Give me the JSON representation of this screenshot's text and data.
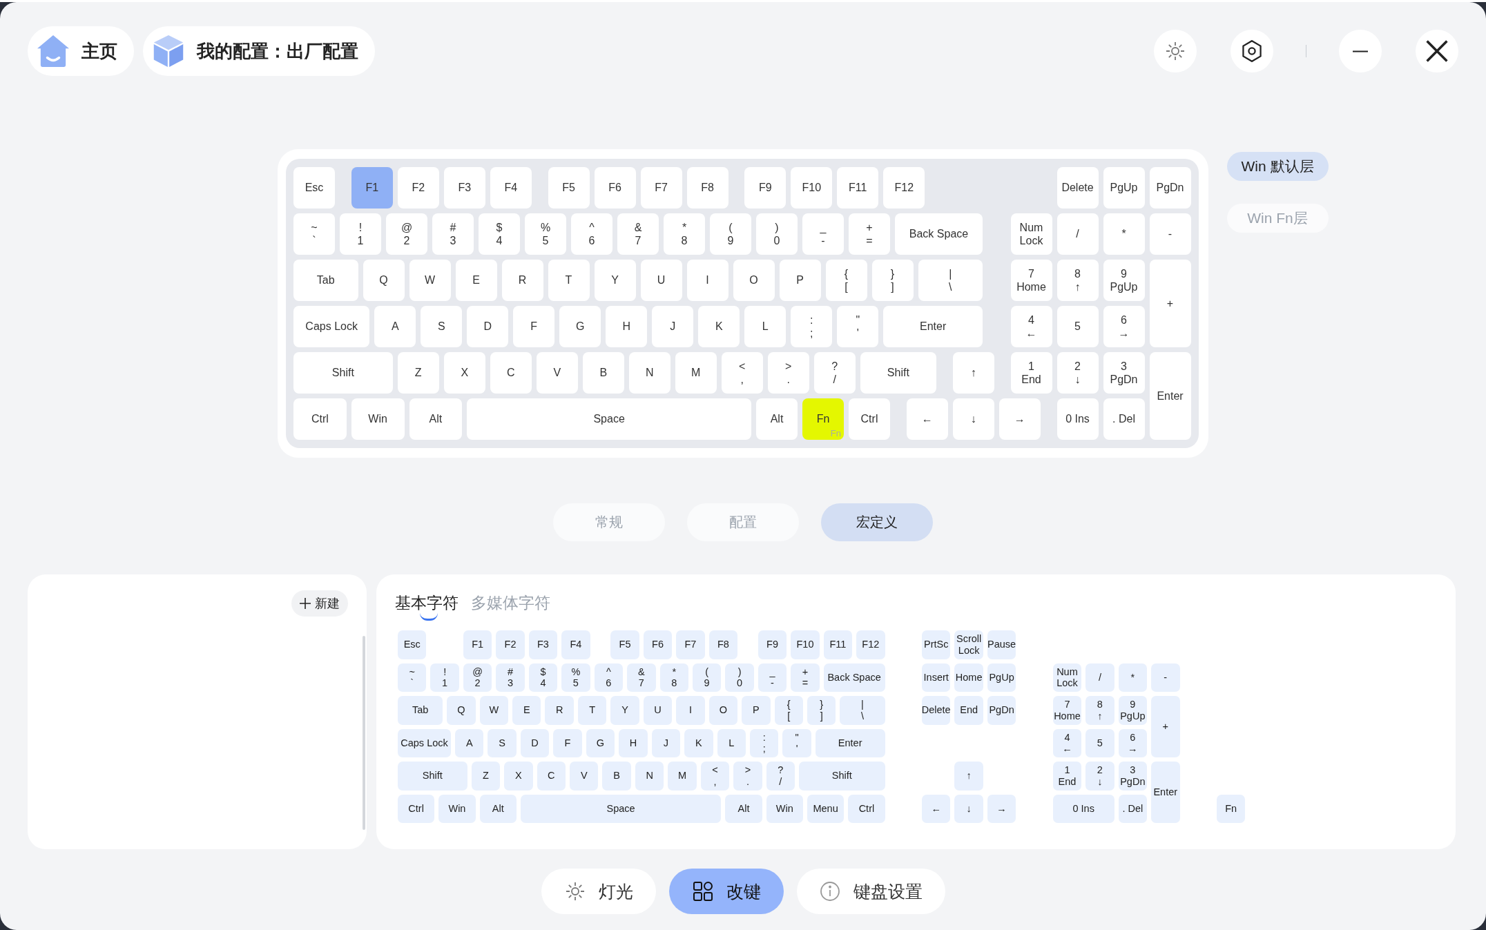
{
  "header": {
    "home": "主页",
    "profile": "我的配置：出厂配置"
  },
  "keyboard": {
    "main_rows": [
      [
        {
          "label": "Esc",
          "selected": false
        },
        {
          "label": "F1",
          "selected": true
        },
        {
          "label": "F2",
          "selected": false
        },
        {
          "label": "F3",
          "selected": false
        },
        {
          "label": "F4",
          "selected": false
        },
        {
          "label": "F5",
          "selected": false
        },
        {
          "label": "F6",
          "selected": false
        },
        {
          "label": "F7",
          "selected": false
        },
        {
          "label": "F8",
          "selected": false
        },
        {
          "label": "F9",
          "selected": false
        },
        {
          "label": "F10",
          "selected": false
        },
        {
          "label": "F11",
          "selected": false
        },
        {
          "label": "F12",
          "selected": false
        }
      ],
      [
        {
          "label": "~\n`",
          "selected": false
        },
        {
          "label": "!\n1",
          "selected": false
        },
        {
          "label": "@\n2",
          "selected": false
        },
        {
          "label": "#\n3",
          "selected": false
        },
        {
          "label": "$\n4",
          "selected": false
        },
        {
          "label": "%\n5",
          "selected": false
        },
        {
          "label": "^\n6",
          "selected": false
        },
        {
          "label": "&\n7",
          "selected": false
        },
        {
          "label": "*\n8",
          "selected": false
        },
        {
          "label": "(\n9",
          "selected": false
        },
        {
          "label": ")\n0",
          "selected": false
        },
        {
          "label": "_\n-",
          "selected": false
        },
        {
          "label": "+\n=",
          "selected": false
        },
        {
          "label": "Back Space",
          "selected": false
        }
      ],
      [
        {
          "label": "Tab",
          "selected": false
        },
        {
          "label": "Q",
          "selected": false
        },
        {
          "label": "W",
          "selected": false
        },
        {
          "label": "E",
          "selected": false
        },
        {
          "label": "R",
          "selected": false
        },
        {
          "label": "T",
          "selected": false
        },
        {
          "label": "Y",
          "selected": false
        },
        {
          "label": "U",
          "selected": false
        },
        {
          "label": "I",
          "selected": false
        },
        {
          "label": "O",
          "selected": false
        },
        {
          "label": "P",
          "selected": false
        },
        {
          "label": "{\n[",
          "selected": false
        },
        {
          "label": "}\n]",
          "selected": false
        },
        {
          "label": "|\n\\",
          "selected": false
        }
      ],
      [
        {
          "label": "Caps Lock",
          "selected": false
        },
        {
          "label": "A",
          "selected": false
        },
        {
          "label": "S",
          "selected": false
        },
        {
          "label": "D",
          "selected": false
        },
        {
          "label": "F",
          "selected": false
        },
        {
          "label": "G",
          "selected": false
        },
        {
          "label": "H",
          "selected": false
        },
        {
          "label": "J",
          "selected": false
        },
        {
          "label": "K",
          "selected": false
        },
        {
          "label": "L",
          "selected": false
        },
        {
          "label": ":\n;",
          "selected": false
        },
        {
          "label": "\"\n'",
          "selected": false
        },
        {
          "label": "Enter",
          "selected": false
        }
      ],
      [
        {
          "label": "Shift",
          "selected": false
        },
        {
          "label": "Z",
          "selected": false
        },
        {
          "label": "X",
          "selected": false
        },
        {
          "label": "C",
          "selected": false
        },
        {
          "label": "V",
          "selected": false
        },
        {
          "label": "B",
          "selected": false
        },
        {
          "label": "N",
          "selected": false
        },
        {
          "label": "M",
          "selected": false
        },
        {
          "label": "<\n,",
          "selected": false
        },
        {
          "label": ">\n.",
          "selected": false
        },
        {
          "label": "?\n/",
          "selected": false
        },
        {
          "label": "Shift",
          "selected": false
        },
        {
          "label": "↑",
          "selected": false
        }
      ],
      [
        {
          "label": "Ctrl",
          "selected": false
        },
        {
          "label": "Win",
          "selected": false
        },
        {
          "label": "Alt",
          "selected": false
        },
        {
          "label": "Space",
          "selected": false
        },
        {
          "label": "Alt",
          "selected": false
        },
        {
          "label": "Fn",
          "sublabel": "Fn",
          "color": "#e4f700",
          "selected": false
        },
        {
          "label": "Ctrl",
          "selected": false
        },
        {
          "label": "←",
          "selected": false
        },
        {
          "label": "↓",
          "selected": false
        },
        {
          "label": "→",
          "selected": false
        }
      ]
    ],
    "numpad_rows": [
      [
        "",
        {
          "label": "Delete",
          "selected": false
        },
        {
          "label": "PgUp",
          "selected": false
        },
        {
          "label": "PgDn",
          "selected": false
        }
      ],
      [
        {
          "label": "Num\nLock",
          "selected": false
        },
        {
          "label": "/",
          "selected": false
        },
        {
          "label": "*",
          "selected": false
        },
        {
          "label": "-",
          "selected": false
        }
      ],
      [
        {
          "label": "7\nHome",
          "selected": false
        },
        {
          "label": "8\n↑",
          "selected": false
        },
        {
          "label": "9\nPgUp",
          "selected": false
        },
        {
          "label": "+",
          "selected": false
        }
      ],
      [
        {
          "label": "4\n←",
          "selected": false
        },
        {
          "label": "5",
          "selected": false
        },
        {
          "label": "6\n→",
          "selected": false
        }
      ],
      [
        {
          "label": "1\nEnd",
          "selected": false
        },
        {
          "label": "2\n↓",
          "selected": false
        },
        {
          "label": "3\nPgDn",
          "selected": false
        },
        {
          "label": "Enter",
          "selected": false
        }
      ],
      [
        "",
        {
          "label": "0 Ins",
          "selected": false
        },
        {
          "label": ". Del",
          "selected": false
        }
      ]
    ]
  },
  "layers": [
    {
      "label": "Win 默认层",
      "selected": true
    },
    {
      "label": "Win Fn层",
      "selected": false
    }
  ],
  "modes": [
    {
      "label": "常规",
      "selected": false
    },
    {
      "label": "配置",
      "selected": false
    },
    {
      "label": "宏定义",
      "selected": true
    }
  ],
  "macro_list": {
    "new_button": "新建"
  },
  "key_picker": {
    "tabs": [
      {
        "label": "基本字符",
        "selected": true
      },
      {
        "label": "多媒体字符",
        "selected": false
      }
    ],
    "main_rows": [
      [
        "Esc",
        "F1",
        "F2",
        "F3",
        "F4",
        "F5",
        "F6",
        "F7",
        "F8",
        "F9",
        "F10",
        "F11",
        "F12"
      ],
      [
        "~\n`",
        "!\n1",
        "@\n2",
        "#\n3",
        "$\n4",
        "%\n5",
        "^\n6",
        "&\n7",
        "*\n8",
        "(\n9",
        ")\n0",
        "_\n-",
        "+\n=",
        "Back Space"
      ],
      [
        "Tab",
        "Q",
        "W",
        "E",
        "R",
        "T",
        "Y",
        "U",
        "I",
        "O",
        "P",
        "{\n[",
        "}\n]",
        "|\n\\"
      ],
      [
        "Caps Lock",
        "A",
        "S",
        "D",
        "F",
        "G",
        "H",
        "J",
        "K",
        "L",
        ":\n;",
        "\"\n'",
        "Enter"
      ],
      [
        "Shift",
        "Z",
        "X",
        "C",
        "V",
        "B",
        "N",
        "M",
        "<\n,",
        ">\n.",
        "?\n/",
        "Shift"
      ],
      [
        "Ctrl",
        "Win",
        "Alt",
        "Space",
        "Alt",
        "Win",
        "Menu",
        "Ctrl"
      ]
    ],
    "nav_rows": [
      [
        "PrtSc",
        "Scroll\nLock",
        "Pause"
      ],
      [
        "Insert",
        "Home",
        "PgUp"
      ],
      [
        "Delete",
        "End",
        "PgDn"
      ],
      [
        "",
        "↑"
      ],
      [
        "←",
        "↓",
        "→"
      ]
    ],
    "numpad_rows": [
      [
        "Num\nLock",
        "/",
        "*",
        "-"
      ],
      [
        "7\nHome",
        "8\n↑",
        "9\nPgUp",
        "+"
      ],
      [
        "4\n←",
        "5",
        "6\n→"
      ],
      [
        "1\nEnd",
        "2\n↓",
        "3\nPgDn",
        "Enter"
      ],
      [
        "0 Ins",
        ". Del"
      ]
    ],
    "fn_key": "Fn"
  },
  "nav": [
    {
      "kind": "light",
      "label": "灯光",
      "selected": false
    },
    {
      "kind": "remap",
      "label": "改键",
      "selected": true
    },
    {
      "kind": "settings",
      "label": "键盘设置",
      "selected": false
    }
  ]
}
